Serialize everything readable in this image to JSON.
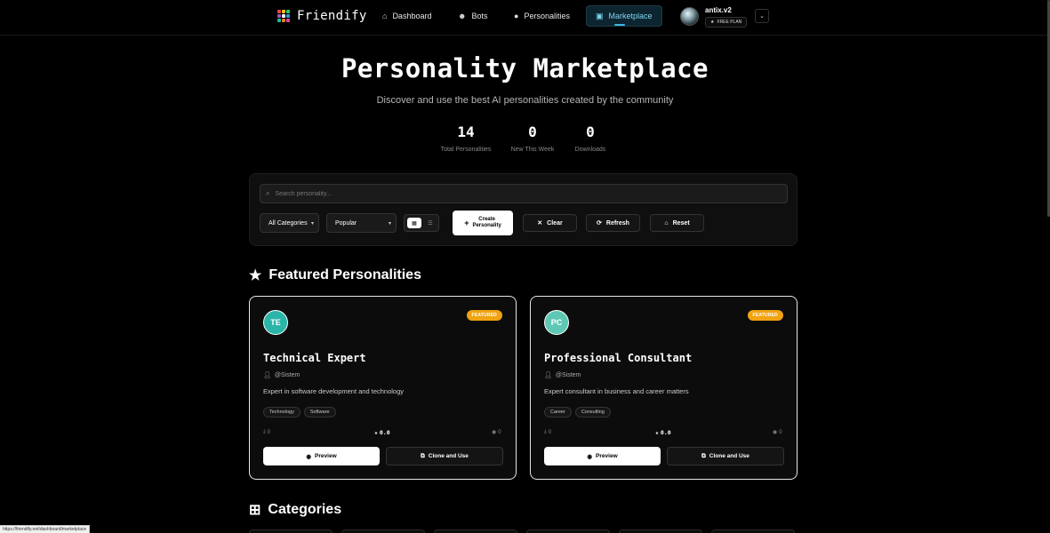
{
  "nav": {
    "brand": "Friendify",
    "links": [
      {
        "label": "Dashboard",
        "icon": "home-icon"
      },
      {
        "label": "Bots",
        "icon": "bot-icon"
      },
      {
        "label": "Personalities",
        "icon": "user-circle-icon"
      },
      {
        "label": "Marketplace",
        "icon": "store-icon",
        "active": true
      }
    ],
    "user": {
      "name": "antix.v2",
      "plan": "FREE PLAN"
    }
  },
  "hero": {
    "title": "Personality Marketplace",
    "subtitle": "Discover and use the best AI personalities created by the community",
    "stats": [
      {
        "value": "14",
        "label": "Total Personalities"
      },
      {
        "value": "0",
        "label": "New This Week"
      },
      {
        "value": "0",
        "label": "Downloads"
      }
    ]
  },
  "filters": {
    "search_placeholder": "Search personality...",
    "category_selected": "All Categories",
    "sort_selected": "Popular",
    "create_label_line1": "Create",
    "create_label_line2": "Personality",
    "clear_label": "Clear",
    "refresh_label": "Refresh",
    "reset_label": "Reset"
  },
  "featured": {
    "heading": "Featured Personalities",
    "badge": "FEATURED",
    "cards": [
      {
        "initials": "TE",
        "title": "Technical Expert",
        "author": "@Sistem",
        "description": "Expert in software development and technology",
        "tags": [
          "Technology",
          "Software"
        ],
        "downloads": "0",
        "rating": "0.0",
        "views": "0",
        "preview_label": "Preview",
        "clone_label": "Clone and Use"
      },
      {
        "initials": "PC",
        "title": "Professional Consultant",
        "author": "@Sistem",
        "description": "Expert consultant in business and career matters",
        "tags": [
          "Career",
          "Consulting"
        ],
        "downloads": "0",
        "rating": "0.0",
        "views": "0",
        "preview_label": "Preview",
        "clone_label": "Clone and Use"
      }
    ]
  },
  "categories": {
    "heading": "Categories"
  },
  "status_url": "https://friendify.net/dashboard/marketplace",
  "colors": {
    "accent": "#3fb6de",
    "featured_badge": "#f1a312",
    "avatar_te": "#2ab5a8",
    "avatar_pc": "#5ec8b4"
  }
}
